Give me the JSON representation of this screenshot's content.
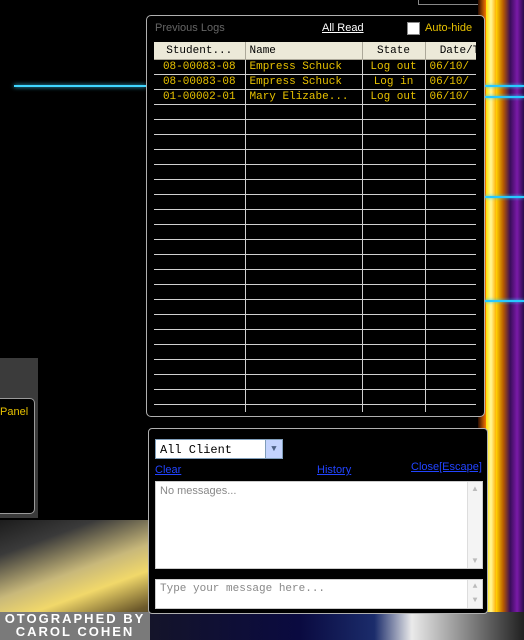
{
  "logs_panel": {
    "title": "Previous Logs",
    "all_read": "All Read",
    "auto_hide": "Auto-hide",
    "columns": [
      "Student...",
      "Name",
      "State",
      "Date/T"
    ],
    "rows": [
      [
        "08-00083-08",
        "Empress Schuck",
        "Log out",
        "06/10/"
      ],
      [
        "08-00083-08",
        "Empress Schuck",
        "Log in",
        "06/10/"
      ],
      [
        "01-00002-01",
        "Mary Elizabe...",
        "Log out",
        "06/10/"
      ]
    ],
    "empty_rows": 21
  },
  "message_panel": {
    "client_select": "All Client",
    "clear": "Clear",
    "history": "History",
    "close": "Close[Escape]",
    "messages_placeholder": "No messages...",
    "input_placeholder": "Type your message here..."
  },
  "background": {
    "side_label": "Panel",
    "photo_credit_line1": "OTOGRAPHED BY",
    "photo_credit_line2": "CAROL COHEN"
  },
  "colors": {
    "accent_text": "#e8c200",
    "link": "#2244ff",
    "glow_line": "#3fd6ff"
  }
}
